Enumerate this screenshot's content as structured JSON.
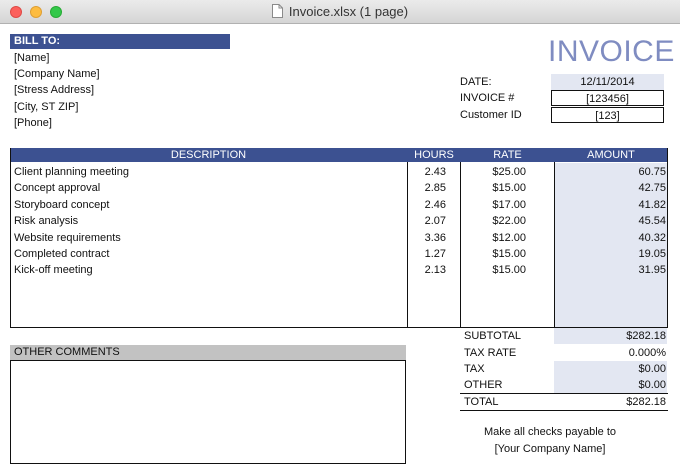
{
  "window": {
    "title": "Invoice.xlsx (1 page)"
  },
  "invoice": {
    "title": "INVOICE",
    "bill_to": {
      "heading": "BILL TO:",
      "lines": [
        "[Name]",
        "[Company Name]",
        "[Stress Address]",
        "[City, ST  ZIP]",
        "[Phone]"
      ]
    },
    "meta": {
      "date_label": "DATE:",
      "date_value": "12/11/2014",
      "invoice_label": "INVOICE #",
      "invoice_value": "[123456]",
      "customer_label": "Customer ID",
      "customer_value": "[123]"
    },
    "table": {
      "headers": {
        "description": "DESCRIPTION",
        "hours": "HOURS",
        "rate": "RATE",
        "amount": "AMOUNT"
      },
      "rows": [
        {
          "description": "Client planning meeting",
          "hours": "2.43",
          "rate": "$25.00",
          "amount": "60.75"
        },
        {
          "description": "Concept approval",
          "hours": "2.85",
          "rate": "$15.00",
          "amount": "42.75"
        },
        {
          "description": "Storyboard concept",
          "hours": "2.46",
          "rate": "$17.00",
          "amount": "41.82"
        },
        {
          "description": "Risk analysis",
          "hours": "2.07",
          "rate": "$22.00",
          "amount": "45.54"
        },
        {
          "description": "Website requirements",
          "hours": "3.36",
          "rate": "$12.00",
          "amount": "40.32"
        },
        {
          "description": "Completed contract",
          "hours": "1.27",
          "rate": "$15.00",
          "amount": "19.05"
        },
        {
          "description": "Kick-off meeting",
          "hours": "2.13",
          "rate": "$15.00",
          "amount": "31.95"
        }
      ]
    },
    "summary": {
      "subtotal_label": "SUBTOTAL",
      "subtotal_value": "$282.18",
      "tax_rate_label": "TAX RATE",
      "tax_rate_value": "0.000%",
      "tax_label": "TAX",
      "tax_value": "$0.00",
      "other_label": "OTHER",
      "other_value": "$0.00",
      "total_label": "TOTAL",
      "total_value": "$282.18"
    },
    "comments": {
      "heading": "OTHER COMMENTS"
    },
    "footer": {
      "line1": "Make all checks payable to",
      "line2": "[Your Company Name]"
    }
  },
  "colors": {
    "header_bg": "#3c5191",
    "title": "#7f8cc1",
    "shade": "#e3e7f2",
    "comments_bg": "#c2c2c2"
  }
}
